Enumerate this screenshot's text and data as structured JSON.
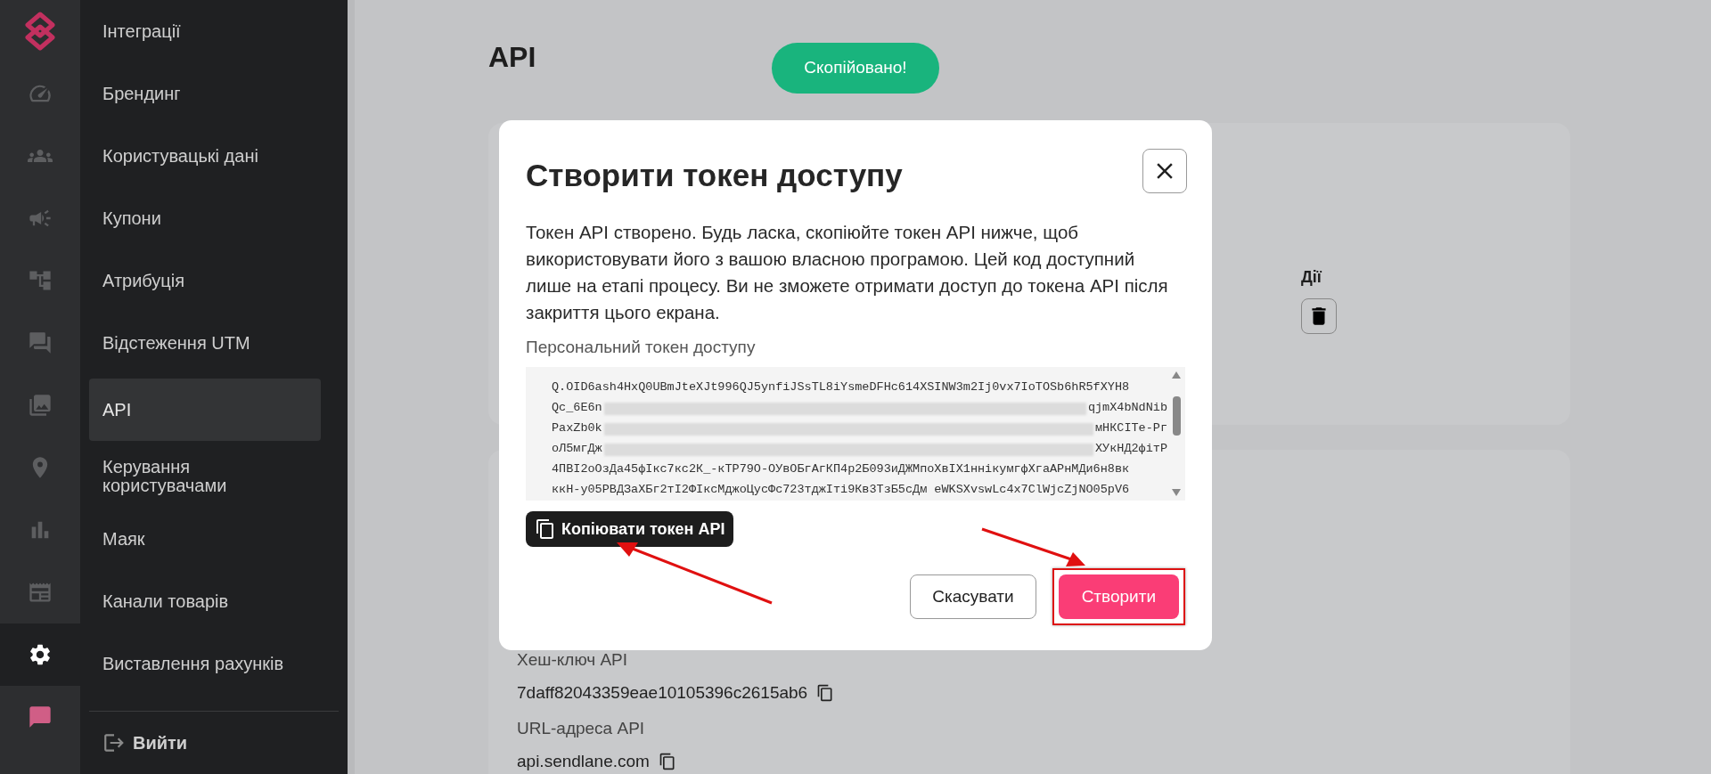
{
  "rail": [
    {
      "selected": false
    },
    {
      "selected": false
    },
    {
      "selected": false
    },
    {
      "selected": false
    },
    {
      "selected": false
    },
    {
      "selected": false
    },
    {
      "selected": false
    },
    {
      "selected": false
    },
    {
      "selected": false
    },
    {
      "selected": false
    },
    {
      "selected": true
    },
    {
      "selected": false
    }
  ],
  "nav": {
    "items": [
      {
        "label": "Інтеграції",
        "selected": false
      },
      {
        "label": "Брендинг",
        "selected": false
      },
      {
        "label": "Користувацькі дані",
        "selected": false
      },
      {
        "label": "Купони",
        "selected": false
      },
      {
        "label": "Атрибуція",
        "selected": false
      },
      {
        "label": "Відстеження UTM",
        "selected": false
      },
      {
        "label": "API",
        "selected": true
      },
      {
        "label": "Керування користувачами",
        "selected": false
      },
      {
        "label": "Маяк",
        "selected": false
      },
      {
        "label": "Канали товарів",
        "selected": false
      },
      {
        "label": "Виставлення рахунків",
        "selected": false
      }
    ],
    "logout": "Вийти"
  },
  "page": {
    "title": "API",
    "toast": "Скопійовано!",
    "actions_header": "Дії",
    "hash_key_label": "Хеш-ключ API",
    "hash_key": "7daff82043359eae10105396c2615ab6",
    "url_label": "URL-адреса API",
    "url": "api.sendlane.com"
  },
  "modal": {
    "title": "Створити токен доступу",
    "body": "Токен API створено. Будь ласка, скопіюйте токен API нижче, щоб використовувати його з вашою власною програмою. Цей код доступний лише на етапі процесу. Ви не зможете отримати доступ до токена API після закриття цього екрана.",
    "token_label": "Персональний токен доступу",
    "token_lines": [
      {
        "start": "Q.OID6ash4HxQ0UBmJteXJt996QJ5ynfiJSsTL8iYsmeDFHc614XSINW3m2Ij0vx7IoTOSb6hR5fXYH8",
        "redacted": false
      },
      {
        "start": "Qc_6E6n",
        "end": "qjmX4bNdNib",
        "redacted": true
      },
      {
        "start": "PaxZb0k",
        "end": "мНКСITe-Рг",
        "redacted": true
      },
      {
        "start": "оЛ5мгДж",
        "end": "ХУкНД2фітР",
        "redacted": true
      },
      {
        "start": "4ПВI2oOзДa45фIкс7кс2К_-кТР79О-ОУвОБгАгКП4р2Б093иДЖМпоХвIХ1ннiкумгфХгаАРнМДи6н8вк",
        "redacted": false
      },
      {
        "start": "ккН-у05РВДЗаХБг2тI2ФIксМджоЦусФс723тджIті9Кв3ТзБ5сДм eWKSXvswLc4x7ClWjcZjNO05pV6",
        "redacted": false
      }
    ],
    "copy_button": "Копіювати токен API",
    "cancel_button": "Скасувати",
    "create_button": {
      "label": "Створити",
      "highlighted": true
    }
  }
}
